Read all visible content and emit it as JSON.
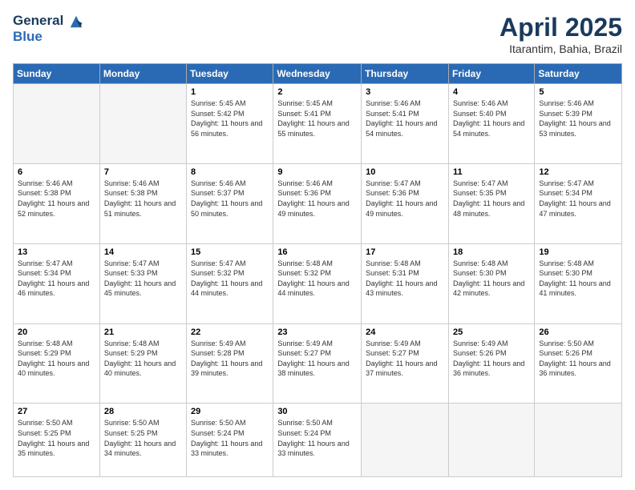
{
  "header": {
    "logo_line1": "General",
    "logo_line2": "Blue",
    "month": "April 2025",
    "location": "Itarantim, Bahia, Brazil"
  },
  "weekdays": [
    "Sunday",
    "Monday",
    "Tuesday",
    "Wednesday",
    "Thursday",
    "Friday",
    "Saturday"
  ],
  "weeks": [
    [
      {
        "day": "",
        "info": ""
      },
      {
        "day": "",
        "info": ""
      },
      {
        "day": "1",
        "info": "Sunrise: 5:45 AM\nSunset: 5:42 PM\nDaylight: 11 hours and 56 minutes."
      },
      {
        "day": "2",
        "info": "Sunrise: 5:45 AM\nSunset: 5:41 PM\nDaylight: 11 hours and 55 minutes."
      },
      {
        "day": "3",
        "info": "Sunrise: 5:46 AM\nSunset: 5:41 PM\nDaylight: 11 hours and 54 minutes."
      },
      {
        "day": "4",
        "info": "Sunrise: 5:46 AM\nSunset: 5:40 PM\nDaylight: 11 hours and 54 minutes."
      },
      {
        "day": "5",
        "info": "Sunrise: 5:46 AM\nSunset: 5:39 PM\nDaylight: 11 hours and 53 minutes."
      }
    ],
    [
      {
        "day": "6",
        "info": "Sunrise: 5:46 AM\nSunset: 5:38 PM\nDaylight: 11 hours and 52 minutes."
      },
      {
        "day": "7",
        "info": "Sunrise: 5:46 AM\nSunset: 5:38 PM\nDaylight: 11 hours and 51 minutes."
      },
      {
        "day": "8",
        "info": "Sunrise: 5:46 AM\nSunset: 5:37 PM\nDaylight: 11 hours and 50 minutes."
      },
      {
        "day": "9",
        "info": "Sunrise: 5:46 AM\nSunset: 5:36 PM\nDaylight: 11 hours and 49 minutes."
      },
      {
        "day": "10",
        "info": "Sunrise: 5:47 AM\nSunset: 5:36 PM\nDaylight: 11 hours and 49 minutes."
      },
      {
        "day": "11",
        "info": "Sunrise: 5:47 AM\nSunset: 5:35 PM\nDaylight: 11 hours and 48 minutes."
      },
      {
        "day": "12",
        "info": "Sunrise: 5:47 AM\nSunset: 5:34 PM\nDaylight: 11 hours and 47 minutes."
      }
    ],
    [
      {
        "day": "13",
        "info": "Sunrise: 5:47 AM\nSunset: 5:34 PM\nDaylight: 11 hours and 46 minutes."
      },
      {
        "day": "14",
        "info": "Sunrise: 5:47 AM\nSunset: 5:33 PM\nDaylight: 11 hours and 45 minutes."
      },
      {
        "day": "15",
        "info": "Sunrise: 5:47 AM\nSunset: 5:32 PM\nDaylight: 11 hours and 44 minutes."
      },
      {
        "day": "16",
        "info": "Sunrise: 5:48 AM\nSunset: 5:32 PM\nDaylight: 11 hours and 44 minutes."
      },
      {
        "day": "17",
        "info": "Sunrise: 5:48 AM\nSunset: 5:31 PM\nDaylight: 11 hours and 43 minutes."
      },
      {
        "day": "18",
        "info": "Sunrise: 5:48 AM\nSunset: 5:30 PM\nDaylight: 11 hours and 42 minutes."
      },
      {
        "day": "19",
        "info": "Sunrise: 5:48 AM\nSunset: 5:30 PM\nDaylight: 11 hours and 41 minutes."
      }
    ],
    [
      {
        "day": "20",
        "info": "Sunrise: 5:48 AM\nSunset: 5:29 PM\nDaylight: 11 hours and 40 minutes."
      },
      {
        "day": "21",
        "info": "Sunrise: 5:48 AM\nSunset: 5:29 PM\nDaylight: 11 hours and 40 minutes."
      },
      {
        "day": "22",
        "info": "Sunrise: 5:49 AM\nSunset: 5:28 PM\nDaylight: 11 hours and 39 minutes."
      },
      {
        "day": "23",
        "info": "Sunrise: 5:49 AM\nSunset: 5:27 PM\nDaylight: 11 hours and 38 minutes."
      },
      {
        "day": "24",
        "info": "Sunrise: 5:49 AM\nSunset: 5:27 PM\nDaylight: 11 hours and 37 minutes."
      },
      {
        "day": "25",
        "info": "Sunrise: 5:49 AM\nSunset: 5:26 PM\nDaylight: 11 hours and 36 minutes."
      },
      {
        "day": "26",
        "info": "Sunrise: 5:50 AM\nSunset: 5:26 PM\nDaylight: 11 hours and 36 minutes."
      }
    ],
    [
      {
        "day": "27",
        "info": "Sunrise: 5:50 AM\nSunset: 5:25 PM\nDaylight: 11 hours and 35 minutes."
      },
      {
        "day": "28",
        "info": "Sunrise: 5:50 AM\nSunset: 5:25 PM\nDaylight: 11 hours and 34 minutes."
      },
      {
        "day": "29",
        "info": "Sunrise: 5:50 AM\nSunset: 5:24 PM\nDaylight: 11 hours and 33 minutes."
      },
      {
        "day": "30",
        "info": "Sunrise: 5:50 AM\nSunset: 5:24 PM\nDaylight: 11 hours and 33 minutes."
      },
      {
        "day": "",
        "info": ""
      },
      {
        "day": "",
        "info": ""
      },
      {
        "day": "",
        "info": ""
      }
    ]
  ]
}
